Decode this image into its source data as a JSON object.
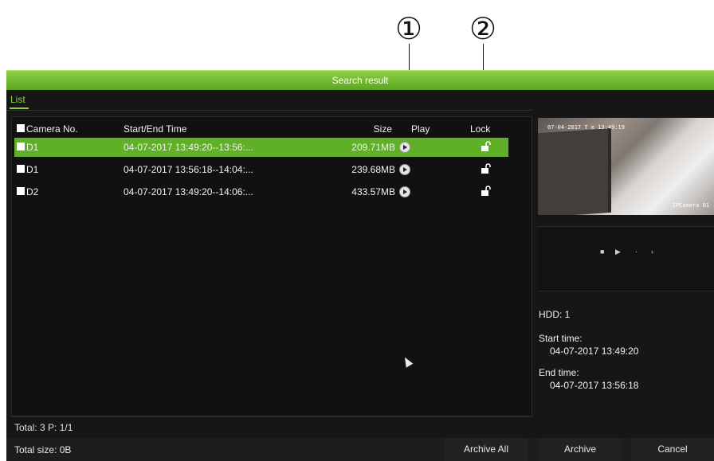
{
  "callouts": {
    "one": "①",
    "two": "②"
  },
  "window": {
    "title": "Search result"
  },
  "tabs": {
    "list": "List"
  },
  "table": {
    "headers": {
      "camera": "Camera No.",
      "time": "Start/End Time",
      "size": "Size",
      "play": "Play",
      "lock": "Lock"
    },
    "rows": [
      {
        "camera": "D1",
        "time": "04-07-2017 13:49:20--13:56:...",
        "size": "209.71MB",
        "selected": true
      },
      {
        "camera": "D1",
        "time": "04-07-2017 13:56:18--14:04:...",
        "size": "239.68MB",
        "selected": false
      },
      {
        "camera": "D2",
        "time": "04-07-2017 13:49:20--14:06:...",
        "size": "433.57MB",
        "selected": false
      }
    ]
  },
  "preview": {
    "timestamp": "07-04-2017 T e 13:49:19",
    "camera_label": "IPCamera 01"
  },
  "details": {
    "hdd": "HDD: 1",
    "start_label": "Start time:",
    "start_value": "04-07-2017 13:49:20",
    "end_label": "End time:",
    "end_value": "04-07-2017 13:56:18"
  },
  "footer": {
    "total": "Total: 3  P: 1/1",
    "total_size": "Total size: 0B",
    "archive_all": "Archive All",
    "archive": "Archive",
    "cancel": "Cancel"
  },
  "colors": {
    "accent": "#5fb026",
    "title_bar": "#72bd2f",
    "background": "#161616"
  },
  "icons": {
    "play": "play-circle-icon",
    "lock": "unlocked-padlock-icon"
  }
}
